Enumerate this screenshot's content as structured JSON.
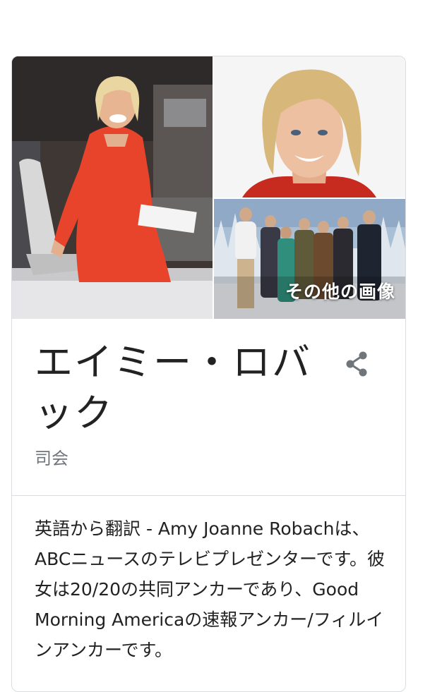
{
  "knowledge_panel": {
    "more_images_label": "その他の画像",
    "title": "エイミー・ロバック",
    "subtitle": "司会",
    "description": "英語から翻訳 - Amy Joanne Robachは、ABCニュースのテレビプレゼンターです。彼女は20/20の共同アンカーであり、Good Morning Americaの速報アンカー/フィルインアンカーです。",
    "icons": {
      "share": "share-icon"
    },
    "colors": {
      "border": "#dadce0",
      "subtitle": "#70757a",
      "share_icon": "#70757a"
    }
  }
}
